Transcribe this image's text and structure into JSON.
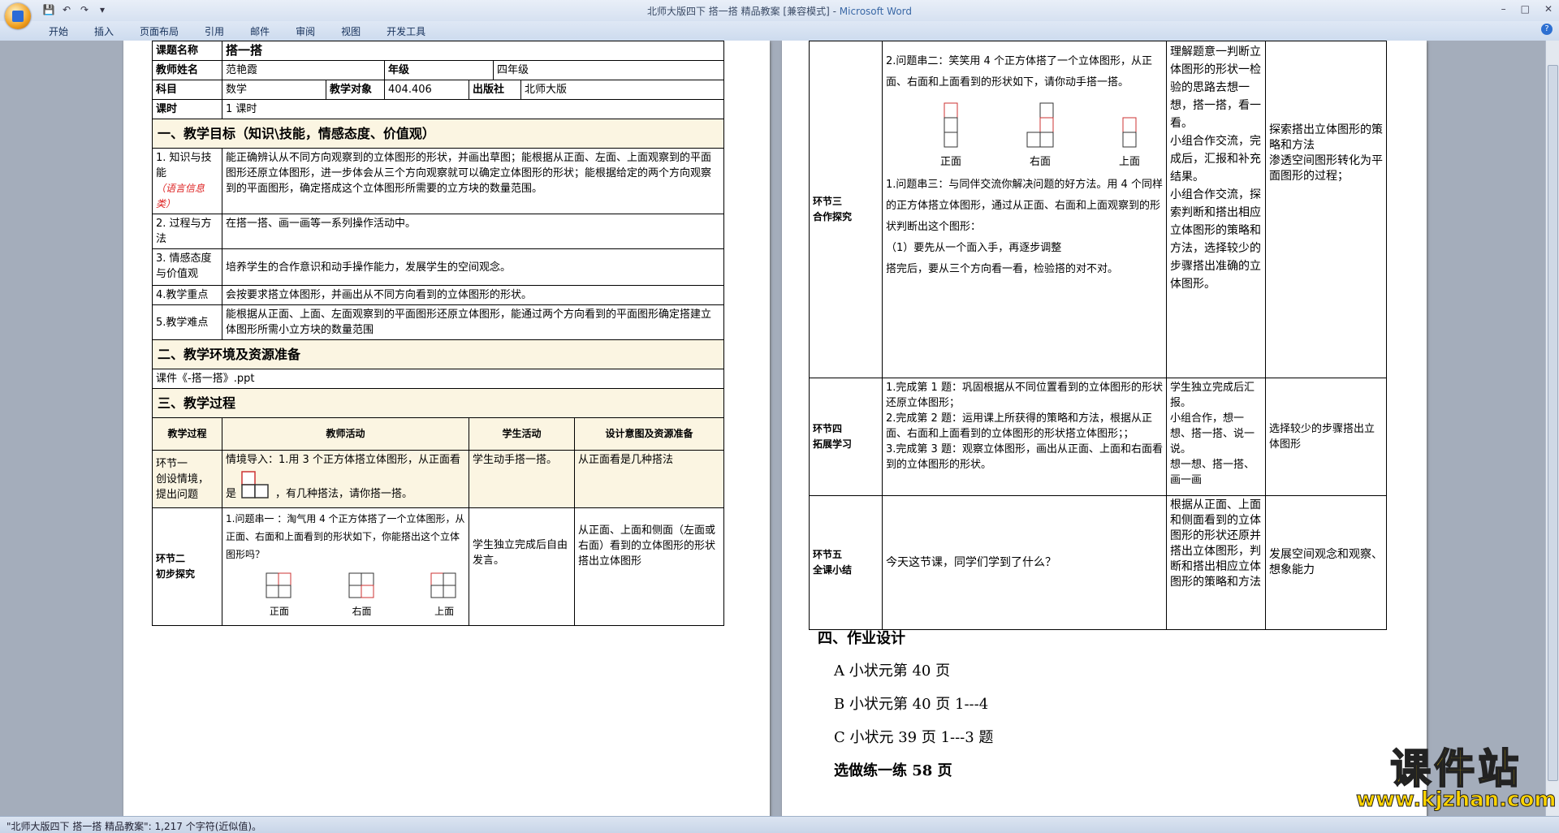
{
  "window": {
    "title": "北师大版四下  搭一搭 精品教案 [兼容模式]",
    "app_name": "Microsoft Word",
    "title_separator": " - "
  },
  "ribbon": {
    "tabs": [
      "开始",
      "插入",
      "页面布局",
      "引用",
      "邮件",
      "审阅",
      "视图",
      "开发工具"
    ]
  },
  "status": {
    "text": "\"北师大版四下  搭一搭 精品教案\": 1,217 个字符(近似值)。"
  },
  "left_page": {
    "topic_label": "课题名称",
    "topic_value": "搭一搭",
    "teacher_label": "教师姓名",
    "teacher_value": "范艳霞",
    "grade_label": "年级",
    "grade_value": "四年级",
    "subject_label": "科目",
    "subject_value": "数学",
    "target_label": "教学对象",
    "target_value": "404.406",
    "publisher_label": "出版社",
    "publisher_value": "北师大版",
    "hours_label": "课时",
    "hours_value": "1 课时",
    "sec1_title": "一、教学目标（知识\\技能，情感态度、价值观）",
    "goal1_label": "1. 知识与技能",
    "goal1_note": "（语言信息类）",
    "goal1_text": "能正确辨认从不同方向观察到的立体图形的形状，并画出草图；能根据从正面、左面、上面观察到的平面图形还原立体图形，进一步体会从三个方向观察就可以确定立体图形的形状；能根据给定的两个方向观察到的平面图形，确定搭成这个立体图形所需要的立方块的数量范围。",
    "goal2_label": "2. 过程与方法",
    "goal2_text": "在搭一搭、画一画等一系列操作活动中。",
    "goal3_label": "3. 情感态度与价值观",
    "goal3_text": "培养学生的合作意识和动手操作能力，发展学生的空间观念。",
    "goal4_label": "4.教学重点",
    "goal4_text": "会按要求搭立体图形，并画出从不同方向看到的立体图形的形状。",
    "goal5_label": "5.教学难点",
    "goal5_text": "能根据从正面、上面、左面观察到的平面图形还原立体图形，能通过两个方向看到的平面图形确定搭建立体图形所需小立方块的数量范围",
    "sec2_title": "二、教学环境及资源准备",
    "resource": "课件《-搭一搭》.ppt",
    "sec3_title": "三、教学过程",
    "headers": [
      "教学过程",
      "教师活动",
      "学生活动",
      "设计意图及资源准备"
    ],
    "stage1": {
      "name": "环节一\n创设情境，提出问题",
      "teacher_a": "情境导入：1.用 3 个正方体搭立体图形，从正面看",
      "teacher_b": "是",
      "teacher_c": "，有几种搭法，请你搭一搭。",
      "student": "学生动手搭一搭。",
      "intent": "从正面看是几种搭法"
    },
    "stage2": {
      "name": "环节二\n初步探究",
      "teacher": "1.问题串一 ：淘气用 4 个正方体搭了一个立体图形，从正面、右面和上面看到的形状如下，你能搭出这个立体图形吗？",
      "fig_labels": [
        "正面",
        "右面",
        "上面"
      ],
      "student": "学生独立完成后自由发言。",
      "intent": "从正面、上面和侧面（左面或右面）看到的立体图形的形状搭出立体图形"
    }
  },
  "right_page": {
    "stage3": {
      "name": "环节三\n合作探究",
      "q2": "2.问题串二：笑笑用 4 个正方体搭了一个立体图形，从正面、右面和上面看到的形状如下，请你动手搭一搭。",
      "fig_labels": [
        "正面",
        "右面",
        "上面"
      ],
      "q3": "1.问题串三：与同伴交流你解决问题的好方法。用 4 个同样的正方体搭立体图形，通过从正面、右面和上面观察到的形状判断出这个图形：",
      "tip1": "（1）要先从一个面入手，再逐步调整",
      "tip2": "搭完后，要从三个方向看一看，检验搭的对不对。",
      "student": "理解题意一判断立体图形的形状一检验的思路去想一想，搭一搭，看一看。\n小组合作交流，完成后，汇报和补充结果。\n小组合作交流，探索判断和搭出相应立体图形的策略和方法，选择较少的步骤搭出准确的立体图形。",
      "intent": "探索搭出立体图形的策略和方法\n渗透空间图形转化为平面图形的过程；"
    },
    "stage4": {
      "name": "环节四\n拓展学习",
      "teacher": "1.完成第 1 题：巩固根据从不同位置看到的立体图形的形状还原立体图形；\n2.完成第 2 题：运用课上所获得的策略和方法，根据从正面、右面和上面看到的立体图形的形状搭立体图形；；\n3.完成第 3 题：观察立体图形，画出从正面、上面和右面看到的立体图形的形状。",
      "student": "学生独立完成后汇报。\n小组合作，想一想、搭一搭、说一说。\n想一想、搭一搭、画一画",
      "intent": "选择较少的步骤搭出立体图形"
    },
    "stage5": {
      "name": "环节五\n全课小结",
      "teacher": "今天这节课，同学们学到了什么？",
      "student": "根据从正面、上面和侧面看到的立体图形的形状还原并搭出立体图形，判断和搭出相应立体图形的策略和方法",
      "intent": "发展空间观念和观察、想象能力"
    },
    "homework": {
      "title": "四、作业设计",
      "lines": [
        "A 小状元第 40 页",
        "B 小状元第 40 页 1---4",
        "C 小状元 39 页 1---3 题",
        "选做练一练 58 页"
      ]
    }
  },
  "watermark": {
    "cn": "课件站",
    "url": "www.kjzhan.com"
  }
}
